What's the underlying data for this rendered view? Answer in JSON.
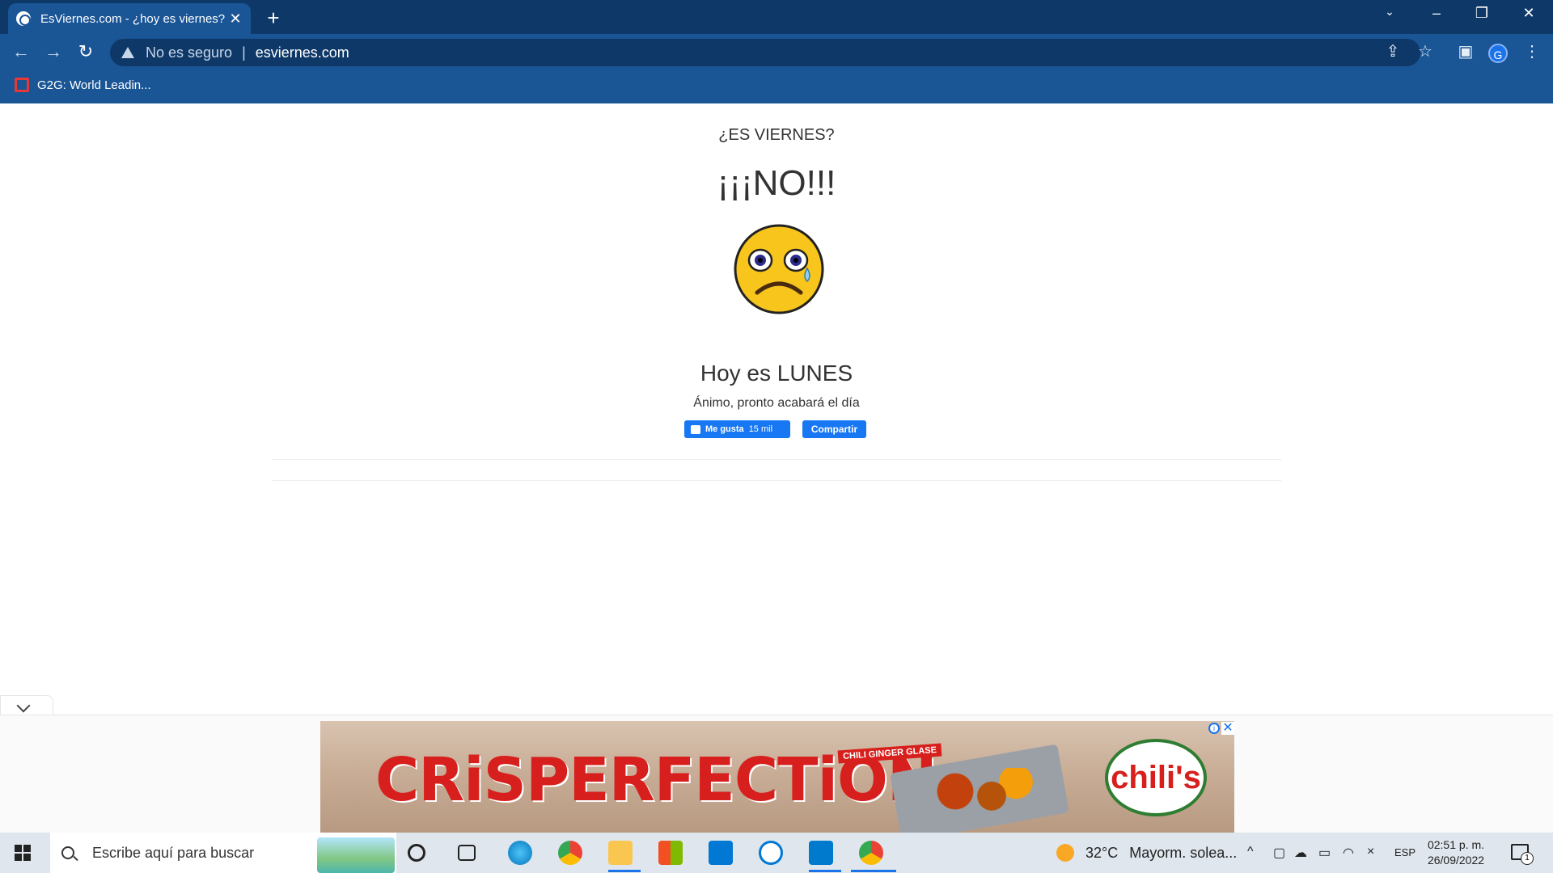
{
  "browser": {
    "tab_title": "EsViernes.com - ¿hoy es viernes?",
    "tab_close": "✕",
    "new_tab": "+",
    "security_label": "No es seguro",
    "url": "esviernes.com",
    "profile_initial": "G",
    "bookmarks": [
      {
        "label": "G2G: World Leadin..."
      }
    ]
  },
  "page": {
    "question": "¿ES VIERNES?",
    "answer": "¡¡¡NO!!!",
    "face": "crying-face-icon",
    "today": "Hoy es LUNES",
    "cheer": "Ánimo, pronto acabará el día",
    "like_label": "Me gusta",
    "like_count": "15 mil",
    "share_label": "Compartir"
  },
  "ad": {
    "headline": "CRiSPERFECTiON",
    "tag": "CHILI GINGER GLASE",
    "brand": "chili's",
    "info_symbol": "i",
    "close_symbol": "✕"
  },
  "taskbar": {
    "search_placeholder": "Escribe aquí para buscar",
    "weather_temp": "32°C",
    "weather_desc": "Mayorm. solea...",
    "language": "ESP",
    "time": "02:51 p. m.",
    "date": "26/09/2022",
    "notification_count": "1"
  },
  "colors": {
    "titlebar": "#0e3868",
    "toolbar": "#1a5596",
    "facebook_blue": "#1877f2",
    "ad_red": "#d7201d"
  }
}
